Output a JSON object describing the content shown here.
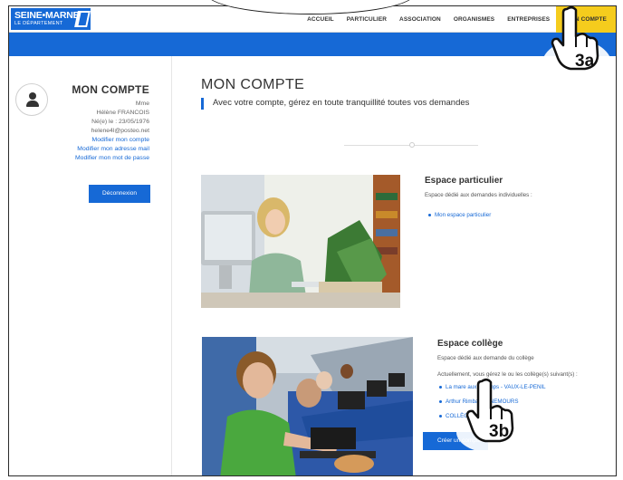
{
  "header": {
    "logo_line1": "SEINE•MARNE",
    "logo_line2": "LE DÉPARTEMENT",
    "nav": [
      {
        "label": "ACCUEIL"
      },
      {
        "label": "PARTICULIER"
      },
      {
        "label": "ASSOCIATION"
      },
      {
        "label": "ORGANISMES"
      },
      {
        "label": "ENTREPRISES"
      },
      {
        "label": "MON COMPTE"
      }
    ],
    "active_color": "#f5cc1d",
    "brand_color": "#1669d6"
  },
  "sidebar": {
    "title": "MON COMPTE",
    "civility": "Mme",
    "name": "Hélène FRANCOIS",
    "birth": "Né(e) le : 23/05/1976",
    "email": "helene4l@posteo.net",
    "links": [
      "Modifier mon compte",
      "Modifier mon adresse mail",
      "Modifier mon mot de passe"
    ],
    "logout_label": "Déconnexion"
  },
  "main": {
    "title": "MON COMPTE",
    "subtitle": "Avec votre compte, gérez en toute tranquillité toutes vos demandes",
    "particulier": {
      "title": "Espace particulier",
      "desc": "Espace dédié aux demandes individuelles :",
      "link": "Mon espace particulier"
    },
    "college": {
      "title": "Espace collège",
      "desc": "Espace dédié aux demande du collège",
      "current": "Actuellement, vous gérez le ou les collège(s) suivant(s) :",
      "colleges": [
        "La mare aux Champs - VAUX-LE-PENIL",
        "Arthur Rimbaud - NEMOURS",
        "COLLÈGE"
      ],
      "create_label": "Créer un compte"
    }
  },
  "annotations": {
    "step_a": "3a",
    "step_b": "3b"
  }
}
